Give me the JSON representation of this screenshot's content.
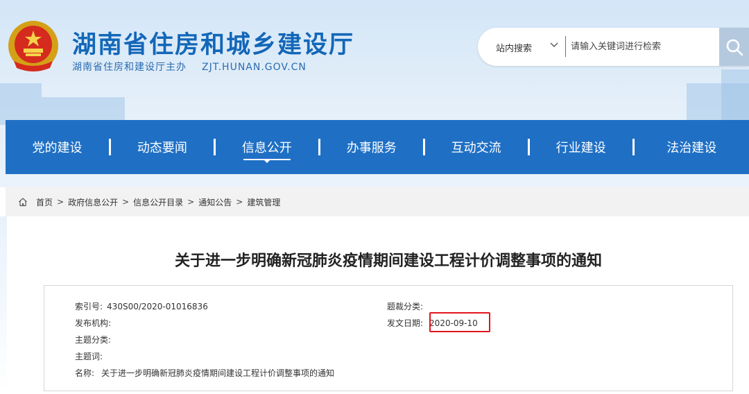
{
  "header": {
    "site_title": "湖南省住房和城乡建设厅",
    "site_sponsor": "湖南省住房和建设厅主办",
    "site_domain": "ZJT.HUNAN.GOV.CN",
    "brand_color": "#1367b8"
  },
  "search": {
    "scope_label": "站内搜索",
    "placeholder": "请输入关键词进行检索",
    "icon": "search-icon"
  },
  "nav": {
    "items": [
      "党的建设",
      "动态要闻",
      "信息公开",
      "办事服务",
      "互动交流",
      "行业建设",
      "法治建设"
    ],
    "active_index": 2,
    "color": "#1f70c5"
  },
  "breadcrumb": {
    "icon": "home-icon",
    "items": [
      "首页",
      "政府信息公开",
      "信息公开目录",
      "通知公告",
      "建筑管理"
    ],
    "separator": ">"
  },
  "article": {
    "title": "关于进一步明确新冠肺炎疫情期间建设工程计价调整事项的通知"
  },
  "meta": {
    "index_no_label": "索引号:",
    "index_no_value": "430S00/2020-01016836",
    "genre_label": "题裁分类:",
    "publisher_label": "发布机构:",
    "date_label": "发文日期:",
    "date_value": "2020-09-10",
    "topic_label": "主题分类:",
    "keywords_label": "主题词:",
    "name_label": "名称:",
    "name_value": "关于进一步明确新冠肺炎疫情期间建设工程计价调整事项的通知",
    "highlight_color": "#e2141c"
  }
}
